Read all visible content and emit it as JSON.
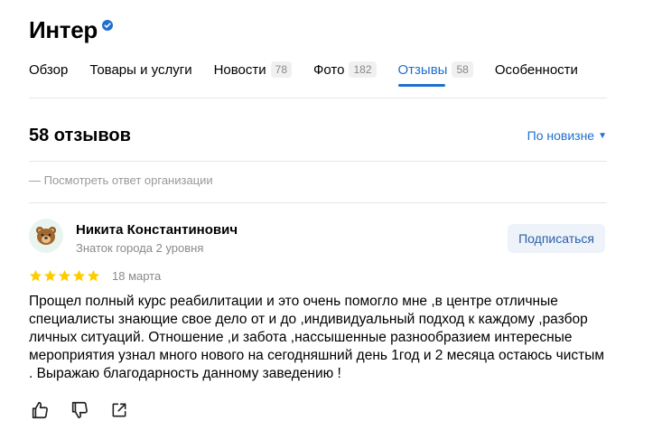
{
  "org": {
    "title": "Интер"
  },
  "tabs": [
    {
      "label": "Обзор",
      "count": ""
    },
    {
      "label": "Товары и услуги",
      "count": ""
    },
    {
      "label": "Новости",
      "count": "78"
    },
    {
      "label": "Фото",
      "count": "182"
    },
    {
      "label": "Отзывы",
      "count": "58"
    },
    {
      "label": "Особенности",
      "count": ""
    }
  ],
  "active_tab": "Отзывы",
  "reviews": {
    "count_label": "58 отзывов",
    "sort_label": "По новизне",
    "org_answer_label": "— Посмотреть ответ организации"
  },
  "review": {
    "author": "Никита Константинович",
    "level": "Знаток города 2 уровня",
    "subscribe_label": "Подписаться",
    "rating": 5,
    "date": "18 марта",
    "text": "Прощел полный курс реабилитации и это очень помогло мне ,в центре отличные специалисты знающие свое дело от и до ,индивидуальный подход к каждому ,разбор личных ситуаций. Отношение ,и забота ,нассышенные разнообразием интересные мероприятия узнал много нового на сегодняшний день 1год и 2 месяца остаюсь чистым . Выражаю благодарность данному заведению !"
  },
  "colors": {
    "accent": "#1f6fd0",
    "star": "#ffcc00",
    "muted": "#8a8a8a"
  },
  "icons": [
    "verified-badge-icon",
    "bear-avatar-icon",
    "star-icon",
    "thumb-up-icon",
    "thumb-down-icon",
    "share-icon"
  ]
}
